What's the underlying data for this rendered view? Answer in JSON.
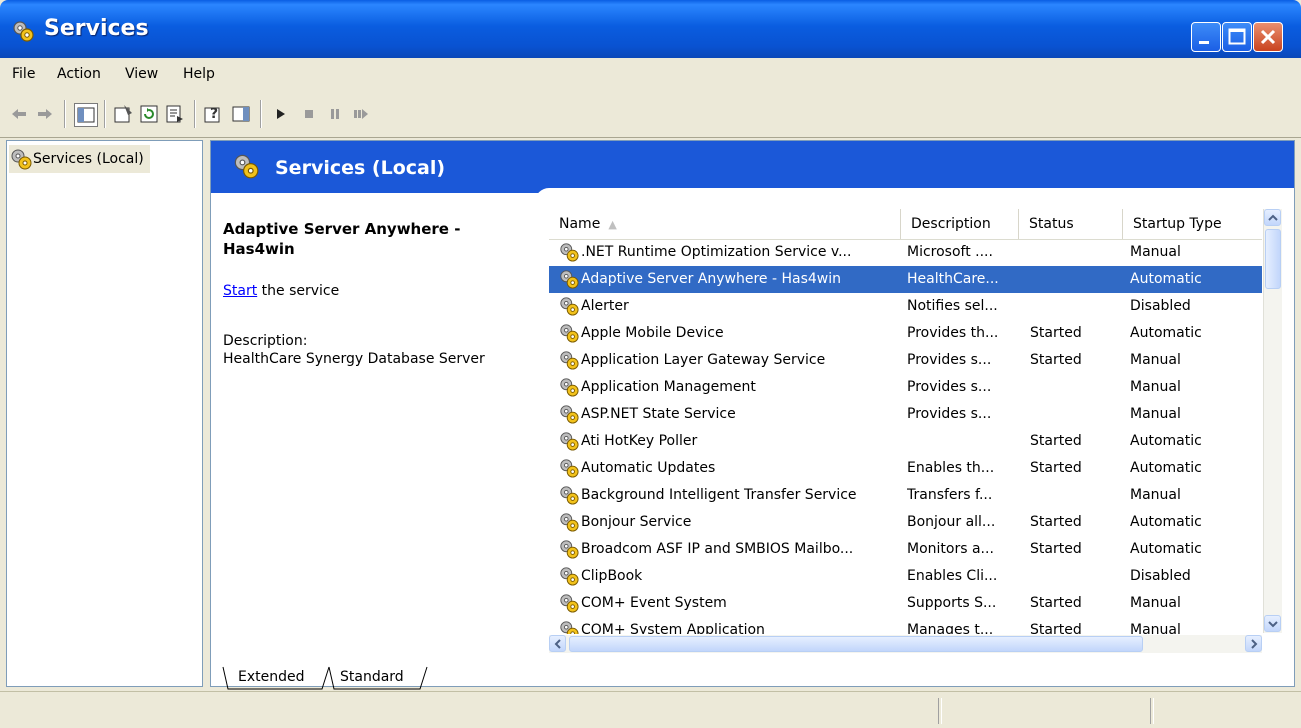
{
  "window": {
    "title": "Services"
  },
  "menu": {
    "items": [
      "File",
      "Action",
      "View",
      "Help"
    ]
  },
  "toolbar": {
    "buttons": [
      "back-arrow-icon",
      "forward-arrow-icon",
      "show-hide-tree-icon",
      "properties-icon",
      "refresh-icon",
      "export-list-icon",
      "help-icon",
      "show-hide-action-pane-icon",
      "start-service-icon",
      "stop-service-icon",
      "pause-service-icon",
      "restart-service-icon"
    ]
  },
  "tree": {
    "root_label": "Services (Local)"
  },
  "banner": {
    "title": "Services (Local)"
  },
  "details": {
    "service_title": "Adaptive Server Anywhere - Has4win",
    "start_link": "Start",
    "start_suffix": " the service",
    "description_label": "Description:",
    "description_text": "HealthCare Synergy Database Server"
  },
  "list": {
    "columns": [
      "Name",
      "Description",
      "Status",
      "Startup Type"
    ],
    "sort_column": "Name",
    "selected_index": 1,
    "rows": [
      {
        "name": ".NET Runtime Optimization Service v...",
        "description": "Microsoft ....",
        "status": "",
        "startup": "Manual"
      },
      {
        "name": "Adaptive Server Anywhere - Has4win",
        "description": "HealthCare...",
        "status": "",
        "startup": "Automatic"
      },
      {
        "name": "Alerter",
        "description": "Notifies sel...",
        "status": "",
        "startup": "Disabled"
      },
      {
        "name": "Apple Mobile Device",
        "description": "Provides th...",
        "status": "Started",
        "startup": "Automatic"
      },
      {
        "name": "Application Layer Gateway Service",
        "description": "Provides s...",
        "status": "Started",
        "startup": "Manual"
      },
      {
        "name": "Application Management",
        "description": "Provides s...",
        "status": "",
        "startup": "Manual"
      },
      {
        "name": "ASP.NET State Service",
        "description": "Provides s...",
        "status": "",
        "startup": "Manual"
      },
      {
        "name": "Ati HotKey Poller",
        "description": "",
        "status": "Started",
        "startup": "Automatic"
      },
      {
        "name": "Automatic Updates",
        "description": "Enables th...",
        "status": "Started",
        "startup": "Automatic"
      },
      {
        "name": "Background Intelligent Transfer Service",
        "description": "Transfers f...",
        "status": "",
        "startup": "Manual"
      },
      {
        "name": "Bonjour Service",
        "description": "Bonjour all...",
        "status": "Started",
        "startup": "Automatic"
      },
      {
        "name": "Broadcom ASF IP and SMBIOS Mailbo...",
        "description": "Monitors a...",
        "status": "Started",
        "startup": "Automatic"
      },
      {
        "name": "ClipBook",
        "description": "Enables Cli...",
        "status": "",
        "startup": "Disabled"
      },
      {
        "name": "COM+ Event System",
        "description": "Supports S...",
        "status": "Started",
        "startup": "Manual"
      },
      {
        "name": "COM+ System Application",
        "description": "Manages t...",
        "status": "Started",
        "startup": "Manual"
      }
    ]
  },
  "tabs": [
    "Extended",
    "Standard"
  ],
  "colors": {
    "title_bar": "#0a5de0",
    "banner": "#1b58d8",
    "selection": "#316ac5",
    "link": "#0000ff"
  }
}
